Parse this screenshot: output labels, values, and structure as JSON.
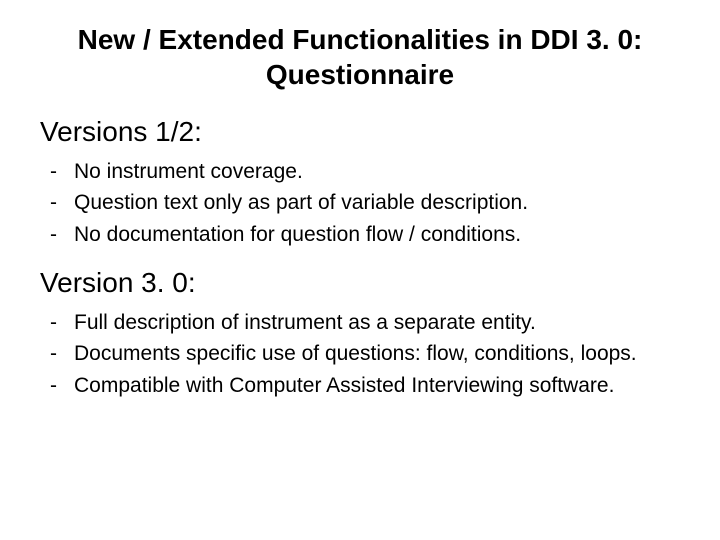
{
  "title": "New / Extended Functionalities in DDI 3. 0: Questionnaire",
  "sections": [
    {
      "heading": "Versions 1/2:",
      "items": [
        "No instrument coverage.",
        "Question text only as part of variable description.",
        "No documentation for question flow / conditions."
      ]
    },
    {
      "heading": "Version 3. 0:",
      "items": [
        "Full description of instrument as a separate entity.",
        "Documents specific use of questions: flow, conditions, loops.",
        "Compatible with Computer Assisted Interviewing software."
      ]
    }
  ]
}
